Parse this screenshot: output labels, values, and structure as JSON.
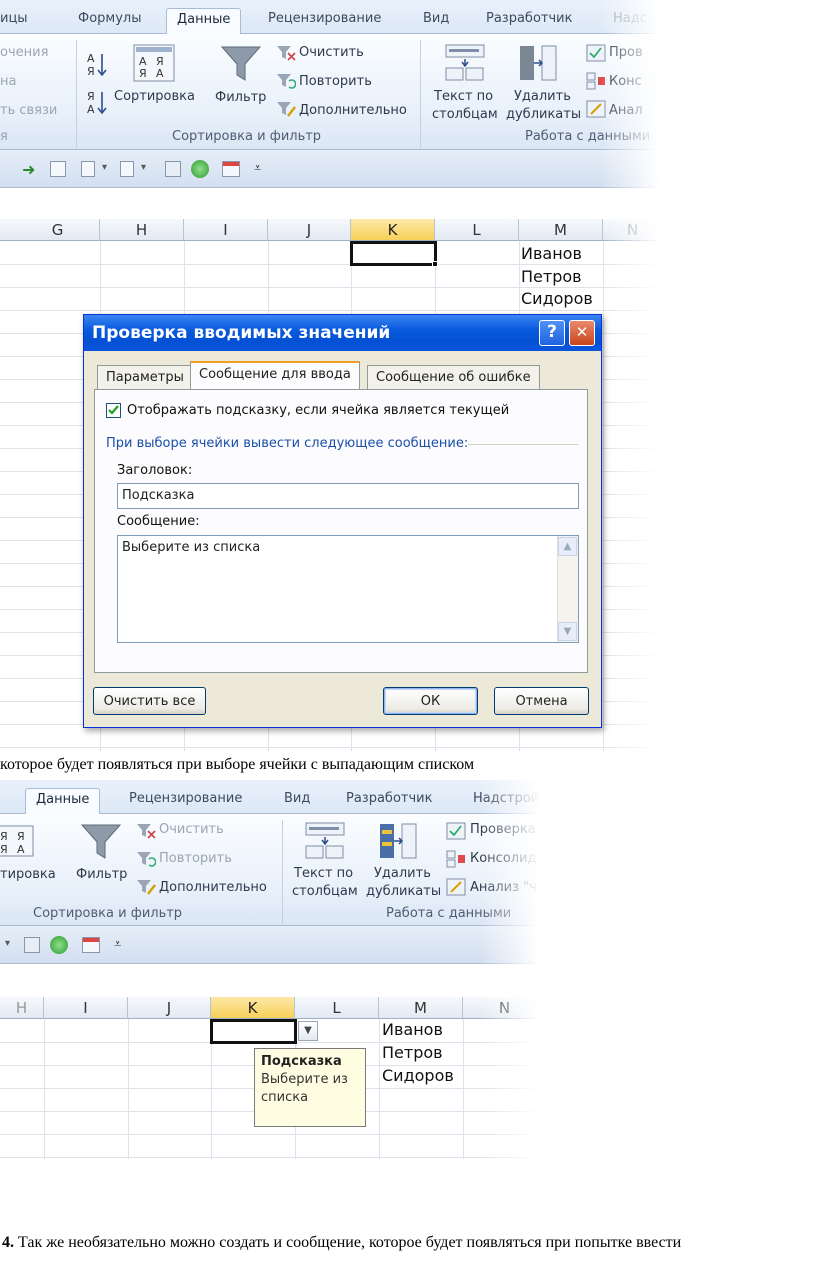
{
  "top": {
    "tabs": [
      "ицы",
      "Формулы",
      "Данные",
      "Рецензирование",
      "Вид",
      "Разработчик",
      "Надс"
    ],
    "left_cut": [
      "очения",
      "на",
      "ть связи",
      "я"
    ],
    "sort_label": "Сортировка",
    "filter_label": "Фильтр",
    "clear_label": "Очистить",
    "repeat_label": "Повторить",
    "advanced_label": "Дополнительно",
    "text_to_cols": [
      "Текст по",
      "столбцам"
    ],
    "remove_dups": [
      "Удалить",
      "дубликаты"
    ],
    "right_cut": [
      "Пров",
      "Конс",
      "Анал"
    ],
    "group_sort": "Сортировка и фильтр",
    "group_data": "Работа с данными",
    "columns": [
      "G",
      "H",
      "I",
      "J",
      "K",
      "L",
      "M",
      "N"
    ],
    "names": [
      "Иванов",
      "Петров",
      "Сидоров"
    ]
  },
  "dialog": {
    "title": "Проверка вводимых значений",
    "help_btn": "?",
    "close_btn": "✕",
    "tabs": [
      "Параметры",
      "Сообщение для ввода",
      "Сообщение об ошибке"
    ],
    "checkbox_label": "Отображать подсказку, если ячейка является текущей",
    "section_label": "При выборе ячейки вывести следующее сообщение:",
    "title_label": "Заголовок:",
    "title_value": "Подсказка",
    "message_label": "Сообщение:",
    "message_value": "Выберите из списка",
    "clear_all": "Очистить все",
    "ok": "ОК",
    "cancel": "Отмена"
  },
  "caption1": "которое будет появляться при выборе ячейки с выпадающим списком",
  "bottom": {
    "tabs": [
      "Данные",
      "Рецензирование",
      "Вид",
      "Разработчик",
      "Надстрой"
    ],
    "sort_cut": "тировка",
    "filter_label": "Фильтр",
    "clear_label": "Очистить",
    "repeat_label": "Повторить",
    "advanced_label": "Дополнительно",
    "text_to_cols": [
      "Текст по",
      "столбцам"
    ],
    "remove_dups": [
      "Удалить",
      "дубликаты"
    ],
    "right_cut": [
      "Проверка",
      "Консолид",
      "Анализ \"ч"
    ],
    "group_sort": "Сортировка и фильтр",
    "group_data": "Работа с данными",
    "columns": [
      "H",
      "I",
      "J",
      "K",
      "L",
      "M",
      "N"
    ],
    "names": [
      "Иванов",
      "Петров",
      "Сидоров"
    ],
    "tooltip_title": "Подсказка",
    "tooltip_text": [
      "Выберите из",
      "списка"
    ]
  },
  "step": {
    "number": "4.",
    "text": " Так же необязательно можно создать и сообщение, которое будет появляться при попытке ввести"
  }
}
